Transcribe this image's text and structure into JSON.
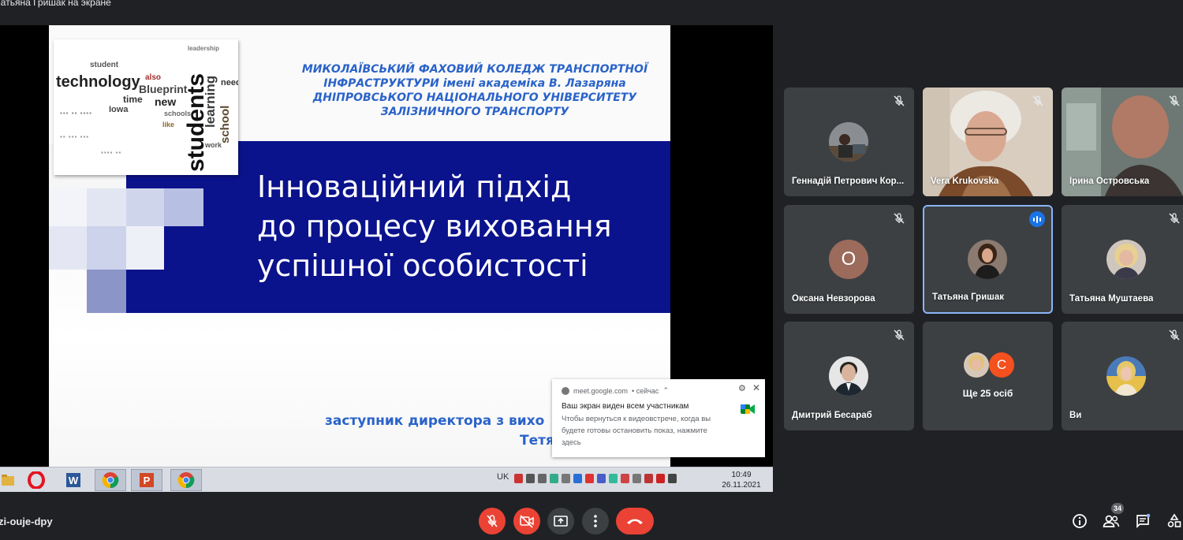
{
  "window": {
    "title": "Татьяна Гришак на экране"
  },
  "slide": {
    "college_lines": [
      "МИКОЛАЇВСЬКИЙ ФАХОВИЙ КОЛЕДЖ ТРАНСПОРТНОЇ",
      "ІНФРАСТРУКТУРИ імені академіка В. Лазаряна",
      "ДНІПРОВСЬКОГО НАЦІОНАЛЬНОГО УНІВЕРСИТЕТУ",
      "ЗАЛІЗНИЧНОГО ТРАНСПОРТУ"
    ],
    "title_lines": [
      "Інноваційний підхід",
      "до процесу виховання",
      "успішної особистості"
    ],
    "author_line1": "заступник директора з вихо",
    "author_line2": "Тетя",
    "wordcloud": {
      "students": "students",
      "technology": "technology",
      "learning": "learning",
      "school": "school",
      "blueprint": "Blueprint",
      "time": "time",
      "new": "new",
      "iowa": "Iowa",
      "student": "student",
      "also": "also",
      "work": "work",
      "need": "need",
      "schools": "schools",
      "leadership": "leadership",
      "like": "like"
    }
  },
  "taskbar": {
    "lang": "UK",
    "time": "10:49",
    "date": "26.11.2021",
    "apps": [
      "file-explorer-icon",
      "opera-icon",
      "word-icon",
      "chrome-icon",
      "powerpoint-icon",
      "chrome-icon"
    ]
  },
  "notification": {
    "source": "meet.google.com",
    "when": "• сейчас",
    "title": "Ваш экран виден всем участникам",
    "body": "Чтобы вернуться к видеовстрече, когда вы будете готовы остановить показ, нажмите здесь"
  },
  "tiles": [
    {
      "name": "Геннадій Петрович Кор...",
      "muted": true
    },
    {
      "name": "Vera Krukovska",
      "muted": true
    },
    {
      "name": "Ірина Островська",
      "muted": true
    },
    {
      "name": "Оксана Невзорова",
      "muted": true,
      "letter": "О"
    },
    {
      "name": "Татьяна Гришак",
      "speaking": true
    },
    {
      "name": "Татьяна Муштаева",
      "muted": true
    },
    {
      "name": "Дмитрий Бесараб",
      "muted": true
    },
    {
      "name": "",
      "more_letter": "С",
      "more_label": "Ще 25 осіб"
    },
    {
      "name": "Ви",
      "muted": true
    }
  ],
  "bottom": {
    "meeting_code": "zi-ouje-dpy",
    "participants_count": "34",
    "colors": {
      "red": "#ea4335",
      "accent": "#1a73e8"
    }
  }
}
